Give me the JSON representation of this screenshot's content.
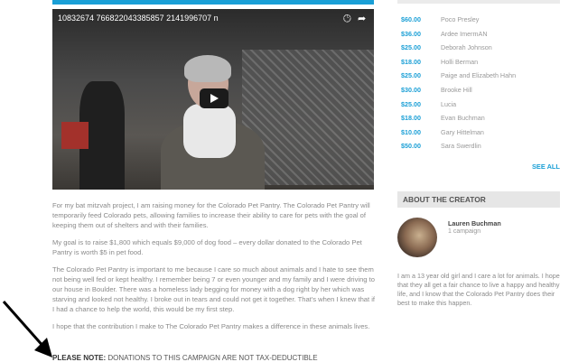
{
  "video": {
    "title": "10832674 766822043385857 2141996707 n",
    "clock_icon": "clock-icon",
    "share_icon": "share-icon",
    "play_icon": "play-icon"
  },
  "story": {
    "paragraphs": [
      "For my bat mitzvah project, I am raising money for the Colorado Pet Pantry. The Colorado Pet Pantry will temporarily feed Colorado pets, allowing families to increase their ability to care for pets with the goal of keeping them out of shelters and with their families.",
      "My goal is to raise $1,800 which equals $9,000 of dog food – every dollar donated to the Colorado Pet Pantry is worth $5 in pet food.",
      "The Colorado Pet Pantry is important to me because I care so much about animals and I hate to see them not being well fed or kept healthy. I remember being 7 or even younger and my family and I were driving to our house in Boulder. There was a homeless lady begging for money with a dog right by her which was starving and looked not healthy. I broke out in tears and could not get it together. That's when I knew that if I had a chance to help the world, this would be my first step.",
      "I hope that the contribution I make to The Colorado Pet Pantry makes a difference in these animals lives."
    ],
    "note_label": "PLEASE NOTE:",
    "note_text": " DONATIONS TO THIS CAMPAIGN ARE NOT TAX-DEDUCTIBLE"
  },
  "donors": [
    {
      "amount": "$60.00",
      "name": "Poco Presley"
    },
    {
      "amount": "$36.00",
      "name": "Ardee ImermAN"
    },
    {
      "amount": "$25.00",
      "name": "Deborah Johnson"
    },
    {
      "amount": "$18.00",
      "name": "Holli Berman"
    },
    {
      "amount": "$25.00",
      "name": "Paige and Elizabeth Hahn"
    },
    {
      "amount": "$30.00",
      "name": "Brooke Hill"
    },
    {
      "amount": "$25.00",
      "name": "Lucia"
    },
    {
      "amount": "$18.00",
      "name": "Evan Buchman"
    },
    {
      "amount": "$10.00",
      "name": "Gary Hittelman"
    },
    {
      "amount": "$50.00",
      "name": "Sara Swerdlin"
    }
  ],
  "see_all": "SEE ALL",
  "about": {
    "header": "ABOUT THE CREATOR",
    "name": "Lauren Buchman",
    "campaigns": "1 campaign",
    "bio": "I am a 13 year old girl and I care a lot for animals. I hope that they all get a fair chance to live a happy and healthy life, and I know that the Colorado Pet Pantry does their best to make this happen."
  },
  "colors": {
    "accent": "#1a9fd6"
  }
}
